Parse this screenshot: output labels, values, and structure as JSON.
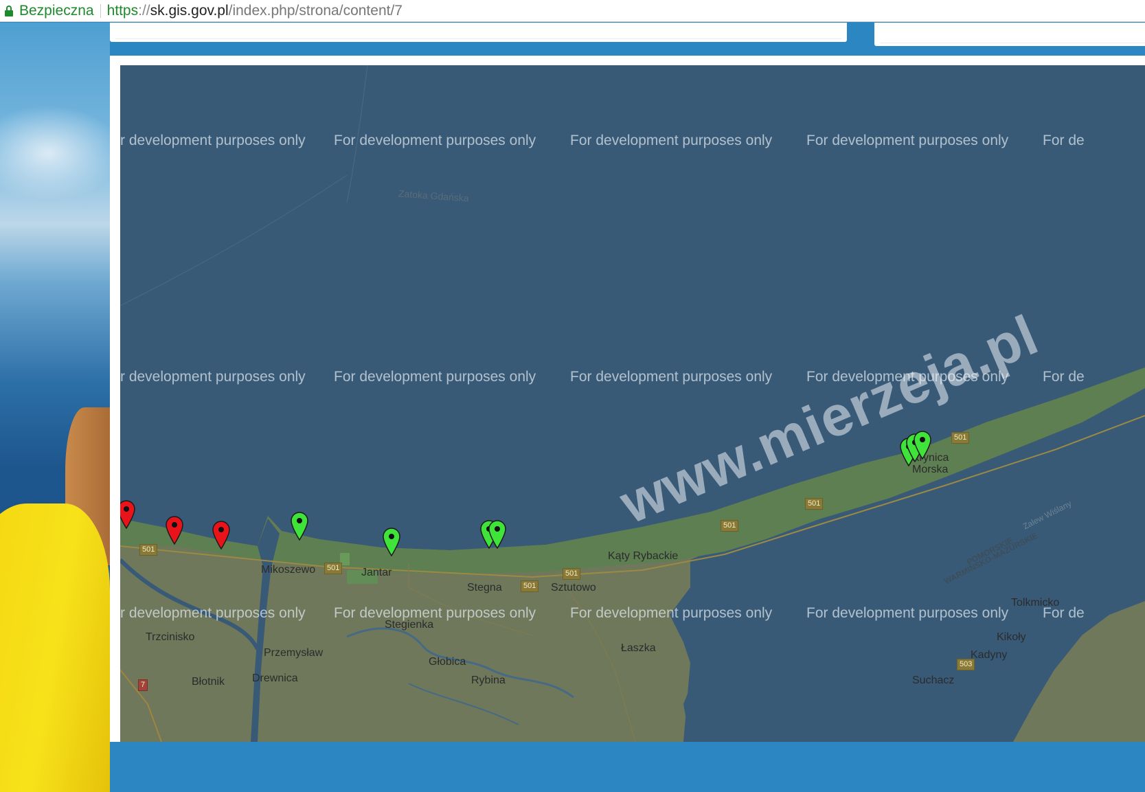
{
  "browser": {
    "secure_label": "Bezpieczna",
    "url_scheme": "https",
    "url_scheme_sep": "://",
    "url_host": "sk.gis.gov.pl",
    "url_path": "/index.php/strona/content/7"
  },
  "map": {
    "dev_watermark": "For development purposes only",
    "dev_watermark_cut_start": "r development purposes only",
    "dev_watermark_cut_end": "For de",
    "brand_watermark": "www.mierzeja.pl",
    "places": {
      "zatoka": "Zatoka Gdańska",
      "mikoszewo": "Mikoszewo",
      "jantar": "Jantar",
      "stegna": "Stegna",
      "sztutowo": "Sztutowo",
      "katy": "Kąty Rybackie",
      "krynica": "Krynica",
      "morska": "Morska",
      "stegienka": "Stegienka",
      "trzcinisko": "Trzcinisko",
      "przemyslaw": "Przemysław",
      "globica": "Głobica",
      "laszka": "Łaszka",
      "tolkmicko": "Tolkmicko",
      "kikoly": "Kikoły",
      "kadyny": "Kadyny",
      "blotnik": "Błotnik",
      "drewnica": "Drewnica",
      "rybina": "Rybina",
      "suchacz": "Suchacz",
      "pomorskie": "POMORSKIE",
      "warminsko": "WARMIŃSKO-MAZURSKIE",
      "zalew": "Zalew Wiślany"
    },
    "roads": {
      "r501": "501",
      "r503": "503",
      "r7": "7"
    },
    "marker_colors": {
      "closed": "#e8141a",
      "open": "#3fe33a"
    },
    "markers": [
      {
        "status": "closed"
      },
      {
        "status": "closed"
      },
      {
        "status": "closed"
      },
      {
        "status": "open"
      },
      {
        "status": "open"
      },
      {
        "status": "open"
      },
      {
        "status": "open"
      },
      {
        "status": "open"
      },
      {
        "status": "open"
      },
      {
        "status": "open"
      }
    ]
  }
}
